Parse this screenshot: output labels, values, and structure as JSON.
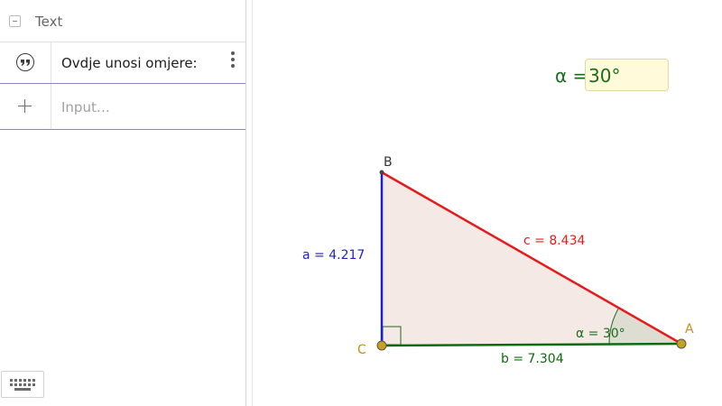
{
  "algebra": {
    "group_title": "Text",
    "text_item": "Ovdje unosi omjere:",
    "input_placeholder": "Input…",
    "input_value": ""
  },
  "graphics": {
    "slider": {
      "label": "α =",
      "value": "30°"
    },
    "points": {
      "A": "A",
      "B": "B",
      "C": "C"
    },
    "segments": {
      "a": "a = 4.217",
      "b": "b = 7.304",
      "c": "c = 8.434"
    },
    "angle_label": "α = 30°",
    "colors": {
      "side_a": "#1f1fcc",
      "side_b": "#0d6b0d",
      "side_c": "#e61a1a",
      "angle_text": "#1d6b1d",
      "point_fill": "#c8a21f",
      "point_label": "#c8900a",
      "triangle_fill": "#f5e9e5"
    }
  },
  "icons": {
    "quote": "quote-icon",
    "more": "more-vertical-icon",
    "add": "plus-icon",
    "keyboard": "keyboard-icon",
    "collapse": "collapse-icon"
  }
}
